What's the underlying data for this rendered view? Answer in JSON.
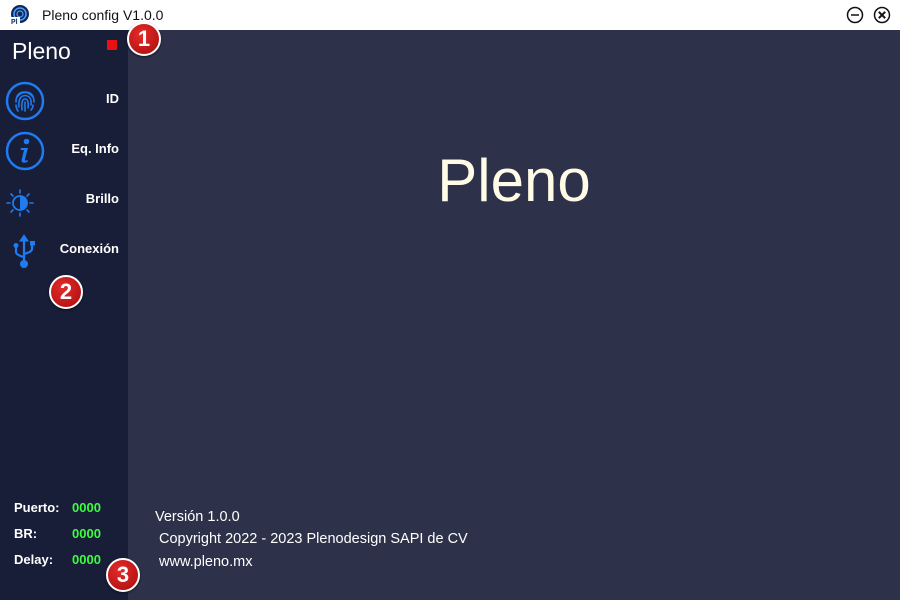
{
  "window": {
    "title": "Pleno config V1.0.0"
  },
  "sidebar": {
    "brand": "Pleno",
    "items": [
      {
        "label": "ID",
        "icon": "fingerprint-icon"
      },
      {
        "label": "Eq. Info",
        "icon": "info-icon"
      },
      {
        "label": "Brillo",
        "icon": "brightness-icon"
      },
      {
        "label": "Conexión",
        "icon": "usb-icon"
      }
    ],
    "stats": [
      {
        "label": "Puerto:",
        "value": "0000"
      },
      {
        "label": "BR:",
        "value": "0000"
      },
      {
        "label": "Delay:",
        "value": "0000"
      }
    ]
  },
  "main": {
    "hero": "Pleno",
    "version": "Versión 1.0.0",
    "copyright": "Copyright 2022 - 2023 Plenodesign SAPI de CV",
    "website": "www.pleno.mx"
  },
  "annotations": [
    "1",
    "2",
    "3"
  ],
  "colors": {
    "sidebar_bg": "#181d38",
    "main_bg": "#2d3149",
    "accent": "#1e7bf0",
    "status": "#e81010",
    "stat_value": "#39ff3d",
    "badge": "#c41414"
  }
}
